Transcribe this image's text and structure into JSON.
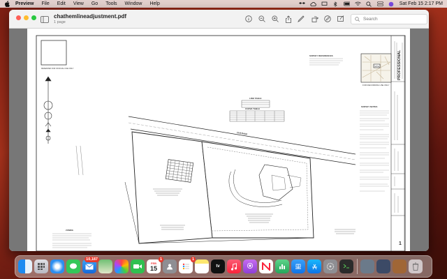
{
  "menubar": {
    "app": "Preview",
    "items": [
      "File",
      "Edit",
      "View",
      "Go",
      "Tools",
      "Window",
      "Help"
    ],
    "datetime": "Sat Feb 15  2:17 PM"
  },
  "window": {
    "title": "chathemlineadjustment.pdf",
    "subtitle": "1 page",
    "search_placeholder": "Search"
  },
  "drawing": {
    "note_top_left": "RESERVED FOR OFFICIAL USE ONLY",
    "survey_references": "SURVEY REFERENCES",
    "recording_use": "FOR RECORDING USE ONLY",
    "survey_notes": "SURVEY NOTES",
    "line_table": "LINE TABLE",
    "curve_table": "CURVE TABLE",
    "road_name": "CHATHAM",
    "firm": "PROFESSIONAL",
    "zoning": "ZONING",
    "map_marker": "SITE",
    "sheet_no": "1"
  },
  "dock": {
    "mail_badge": "10,187",
    "calendar_month": "FEB",
    "calendar_day": "15",
    "cal_badge": "1",
    "messages_badge": "1",
    "reminders_badge": "1"
  }
}
